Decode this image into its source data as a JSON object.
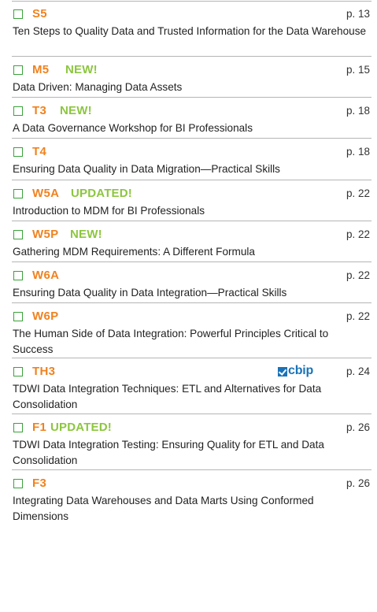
{
  "courses": [
    {
      "code": "S5",
      "tag": "",
      "page": "p. 13",
      "title": "Ten Steps to Quality Data and Trusted Information for the Data Warehouse"
    },
    {
      "code": "M5",
      "tag": "NEW!",
      "page": "p. 15",
      "title": "Data Driven: Managing Data Assets"
    },
    {
      "code": "T3",
      "tag": "NEW!",
      "page": "p. 18",
      "title": "A Data Governance Workshop for BI Professionals"
    },
    {
      "code": "T4",
      "tag": "",
      "page": "p. 18",
      "title": "Ensuring Data Quality in Data Migration—Practical Skills"
    },
    {
      "code": "W5A",
      "tag": "UPDATED!",
      "page": "p. 22",
      "title": "Introduction to MDM for BI Professionals"
    },
    {
      "code": "W5P",
      "tag": "NEW!",
      "page": "p. 22",
      "title": "Gathering MDM Requirements: A Different Formula"
    },
    {
      "code": "W6A",
      "tag": "",
      "page": "p. 22",
      "title": "Ensuring Data Quality in Data Integration—Practical Skills"
    },
    {
      "code": "W6P",
      "tag": "",
      "page": "p. 22",
      "title": "The Human Side of Data Integration: Powerful Principles Critical to Success"
    },
    {
      "code": "TH3",
      "tag": "",
      "page": "p. 24",
      "title": "TDWI Data Integration Techniques: ETL and Alternatives for Data Consolidation",
      "badge": "cbip"
    },
    {
      "code": "F1",
      "tag": "UPDATED!",
      "page": "p. 26",
      "title": "TDWI Data Integration Testing: Ensuring Quality for ETL and Data Consolidation"
    },
    {
      "code": "F3",
      "tag": "",
      "page": "p. 26",
      "title": "Integrating Data Warehouses and Data Marts Using Conformed Dimensions"
    }
  ],
  "colors": {
    "code": "#f0821e",
    "tag": "#8cc63f",
    "checkbox": "#3aa23a",
    "cbip": "#1a73b8",
    "rule": "#b5b5b5"
  }
}
